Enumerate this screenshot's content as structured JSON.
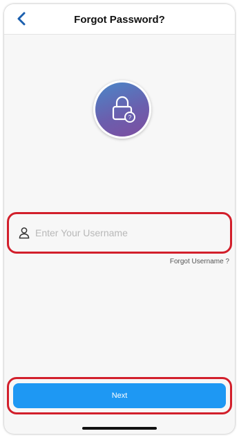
{
  "header": {
    "title": "Forgot Password?",
    "back_icon": "chevron-left-icon"
  },
  "hero": {
    "icon": "lock-question-icon",
    "gradient": [
      "#4a87c8",
      "#7e4ea0"
    ]
  },
  "form": {
    "username_placeholder": "Enter Your Username",
    "username_value": "",
    "username_icon": "user-icon",
    "forgot_username_label": "Forgot Username ?"
  },
  "actions": {
    "next_label": "Next"
  },
  "colors": {
    "accent": "#1e98f3",
    "highlight": "#d21f2b",
    "back_chevron": "#1b5fae"
  }
}
